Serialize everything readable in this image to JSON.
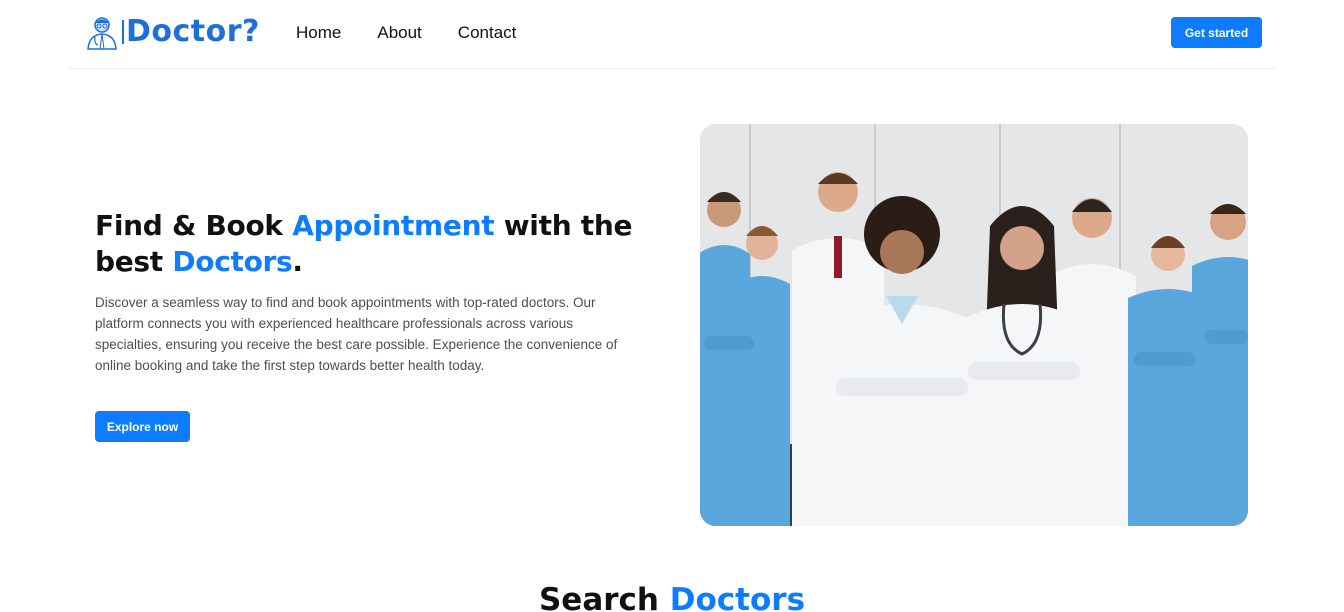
{
  "header": {
    "logo_text": "Doctor?",
    "nav": [
      "Home",
      "About",
      "Contact"
    ],
    "cta_label": "Get started"
  },
  "hero": {
    "title_part1": "Find & Book ",
    "title_accent1": "Appointment",
    "title_part2": " with the best ",
    "title_accent2": "Doctors",
    "title_part3": ".",
    "description": "Discover a seamless way to find and book appointments with top-rated doctors. Our platform connects you with experienced healthcare professionals across various specialties, ensuring you receive the best care possible. Experience the convenience of online booking and take the first step towards better health today.",
    "button_label": "Explore now"
  },
  "section": {
    "title_part1": "Search ",
    "title_accent": "Doctors"
  },
  "colors": {
    "accent": "#0d7cff",
    "logo": "#1e6fd9",
    "text": "#111111",
    "muted": "#4a4f57",
    "scrub": "#5aa7dd",
    "coat": "#f4f6f8"
  }
}
